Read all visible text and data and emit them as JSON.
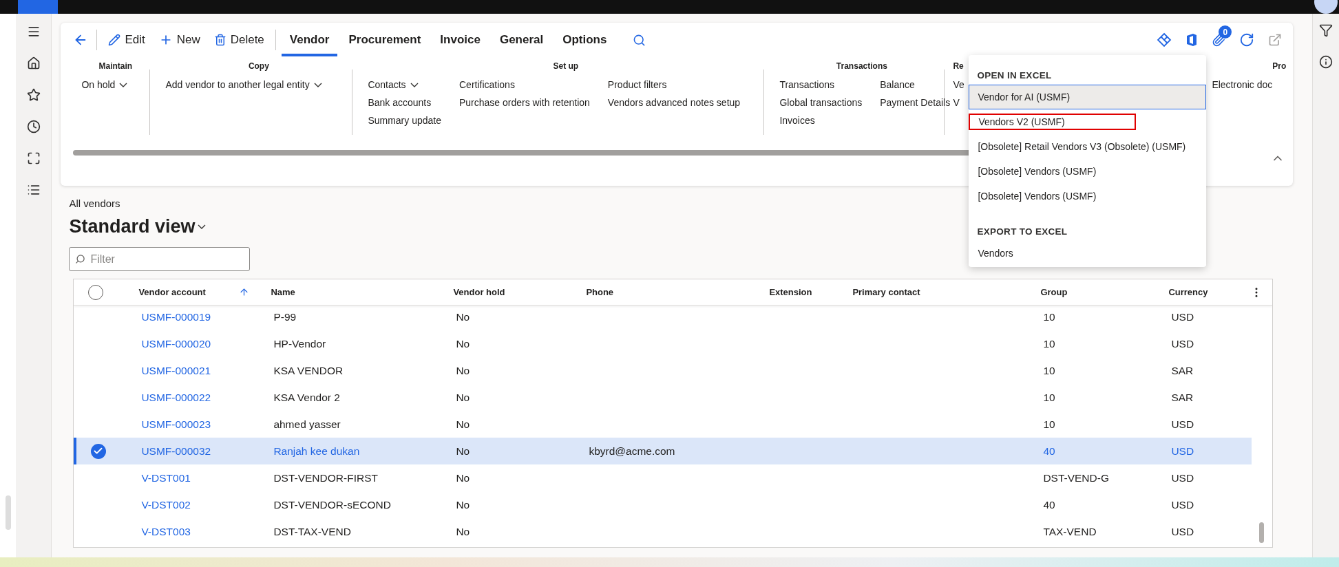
{
  "toolbar": {
    "actions": [
      {
        "kind": "edit",
        "label": "Edit"
      },
      {
        "kind": "new",
        "label": "New"
      },
      {
        "kind": "delete",
        "label": "Delete"
      }
    ],
    "tabs": [
      {
        "label": "Vendor",
        "selected": true
      },
      {
        "label": "Procurement",
        "selected": false
      },
      {
        "label": "Invoice",
        "selected": false
      },
      {
        "label": "General",
        "selected": false
      },
      {
        "label": "Options",
        "selected": false
      }
    ],
    "attachments_badge": "0"
  },
  "ribbon": {
    "groups": [
      {
        "title": "Maintain",
        "columns": [
          [
            {
              "label": "On hold",
              "dropdown": true
            }
          ]
        ]
      },
      {
        "title": "Copy",
        "columns": [
          [
            {
              "label": "Add vendor to another legal entity",
              "dropdown": true
            }
          ]
        ]
      },
      {
        "title": "Set up",
        "columns": [
          [
            {
              "label": "Contacts",
              "dropdown": true
            },
            {
              "label": "Bank accounts",
              "dropdown": false
            },
            {
              "label": "Summary update",
              "dropdown": false
            }
          ],
          [
            {
              "label": "Certifications",
              "dropdown": false
            },
            {
              "label": "Purchase orders with retention",
              "dropdown": false
            }
          ],
          [
            {
              "label": "Product filters",
              "dropdown": false
            },
            {
              "label": "Vendors advanced notes setup",
              "dropdown": false
            }
          ]
        ]
      },
      {
        "title": "Transactions",
        "columns": [
          [
            {
              "label": "Transactions",
              "dropdown": false
            },
            {
              "label": "Global transactions",
              "dropdown": false
            },
            {
              "label": "Invoices",
              "dropdown": false
            }
          ],
          [
            {
              "label": "Balance",
              "dropdown": false
            },
            {
              "label": "Payment Details",
              "dropdown": false
            }
          ]
        ]
      },
      {
        "title": "Re",
        "columns": [
          [
            {
              "label": "Ve",
              "dropdown": false
            },
            {
              "label": "V",
              "dropdown": false
            }
          ]
        ]
      },
      {
        "title": "Pro",
        "columns": [
          [
            {
              "label": "Electronic doc",
              "dropdown": false
            }
          ]
        ]
      }
    ]
  },
  "excel_menu": {
    "sections": [
      {
        "heading": "OPEN IN EXCEL",
        "items": [
          {
            "label": "Vendor for AI (USMF)",
            "selected": true,
            "outlined": false
          },
          {
            "label": "Vendors V2 (USMF)",
            "selected": false,
            "outlined": true
          },
          {
            "label": "[Obsolete] Retail Vendors V3 (Obsolete) (USMF)",
            "selected": false,
            "outlined": false
          },
          {
            "label": "[Obsolete] Vendors (USMF)",
            "selected": false,
            "outlined": false
          },
          {
            "label": "[Obsolete] Vendors (USMF)",
            "selected": false,
            "outlined": false
          }
        ]
      },
      {
        "heading": "EXPORT TO EXCEL",
        "items": [
          {
            "label": "Vendors",
            "selected": false,
            "outlined": false
          }
        ]
      }
    ]
  },
  "page": {
    "breadcrumb": "All vendors",
    "view_title": "Standard view"
  },
  "filter": {
    "placeholder": "Filter"
  },
  "table": {
    "select_all": {
      "checked": false
    },
    "columns": [
      {
        "label": "Vendor account",
        "sorted": true
      },
      {
        "label": "Name",
        "sorted": false
      },
      {
        "label": "Vendor hold",
        "sorted": false
      },
      {
        "label": "Phone",
        "sorted": false
      },
      {
        "label": "Extension",
        "sorted": false
      },
      {
        "label": "Primary contact",
        "sorted": false
      },
      {
        "label": "Group",
        "sorted": false
      },
      {
        "label": "Currency",
        "sorted": false
      }
    ],
    "rows": [
      {
        "selected": false,
        "cells": [
          "USMF-000019",
          "P-99",
          "No",
          "",
          "",
          "",
          "10",
          "USD"
        ]
      },
      {
        "selected": false,
        "cells": [
          "USMF-000020",
          "HP-Vendor",
          "No",
          "",
          "",
          "",
          "10",
          "USD"
        ]
      },
      {
        "selected": false,
        "cells": [
          "USMF-000021",
          "KSA VENDOR",
          "No",
          "",
          "",
          "",
          "10",
          "SAR"
        ]
      },
      {
        "selected": false,
        "cells": [
          "USMF-000022",
          "KSA Vendor 2",
          "No",
          "",
          "",
          "",
          "10",
          "SAR"
        ]
      },
      {
        "selected": false,
        "cells": [
          "USMF-000023",
          "ahmed yasser",
          "No",
          "",
          "",
          "",
          "10",
          "USD"
        ]
      },
      {
        "selected": true,
        "cells": [
          "USMF-000032",
          "Ranjah kee dukan",
          "No",
          "kbyrd@acme.com",
          "",
          "",
          "40",
          "USD"
        ]
      },
      {
        "selected": false,
        "cells": [
          "V-DST001",
          "DST-VENDOR-FIRST",
          "No",
          "",
          "",
          "",
          "DST-VEND-G",
          "USD"
        ]
      },
      {
        "selected": false,
        "cells": [
          "V-DST002",
          "DST-VENDOR-sECOND",
          "No",
          "",
          "",
          "",
          "40",
          "USD"
        ]
      },
      {
        "selected": false,
        "cells": [
          "V-DST003",
          "DST-TAX-VEND",
          "No",
          "",
          "",
          "",
          "TAX-VEND",
          "USD"
        ]
      }
    ]
  }
}
